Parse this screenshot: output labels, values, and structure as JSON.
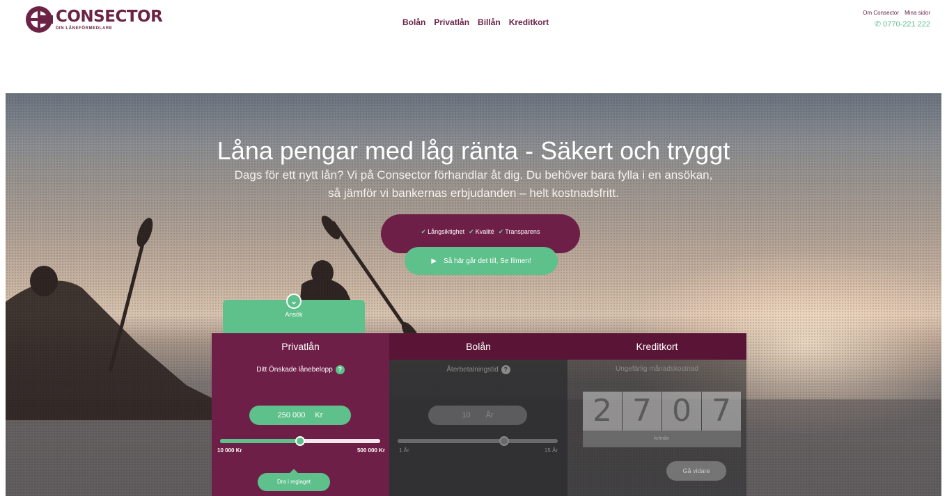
{
  "brand": {
    "name": "CONSECTOR",
    "tagline": "DIN LÅNEFÖRMEDLARE",
    "color": "#6b2346",
    "accent": "#5ec08a"
  },
  "nav": {
    "items": [
      "Bolån",
      "Privatlån",
      "Billån",
      "Kreditkort"
    ]
  },
  "top_links": {
    "about": "Om Consector",
    "my_pages": "Mina sidor",
    "phone": "0770-221 222",
    "phone_icon": "phone-icon"
  },
  "hero": {
    "title": "Låna pengar med låg ränta - Säkert och tryggt",
    "subtitle": "Dags för ett nytt lån? Vi på Consector förhandlar åt dig. Du behöver bara fylla i en ansökan, så jämför vi bankernas erbjudanden – helt kostnadsfritt.",
    "values": [
      "Långsiktighet",
      "Kvalité",
      "Transparens"
    ],
    "film_button": "Så här går det till, Se filmen!"
  },
  "calculator": {
    "ansok_tab": "Ansök",
    "tabs": [
      "Privatlån",
      "Bolån",
      "Kreditkort"
    ],
    "amount": {
      "label": "Ditt Önskade lånebelopp",
      "value": "250 000",
      "unit": "Kr",
      "min": "10 000 Kr",
      "max": "500 000 Kr",
      "slider_fraction": 0.5,
      "drag_hint": "Dra i reglaget"
    },
    "term": {
      "label": "Återbetalningstid",
      "value": "10",
      "unit": "År",
      "min": "1 År",
      "max": "15 År",
      "slider_fraction": 0.64
    },
    "monthly": {
      "label": "Ungefärlig månadskostnad",
      "digits": [
        "2",
        "7",
        "0",
        "7"
      ],
      "footnote": "kr/mån",
      "apply_button": "Gå vidare"
    }
  }
}
